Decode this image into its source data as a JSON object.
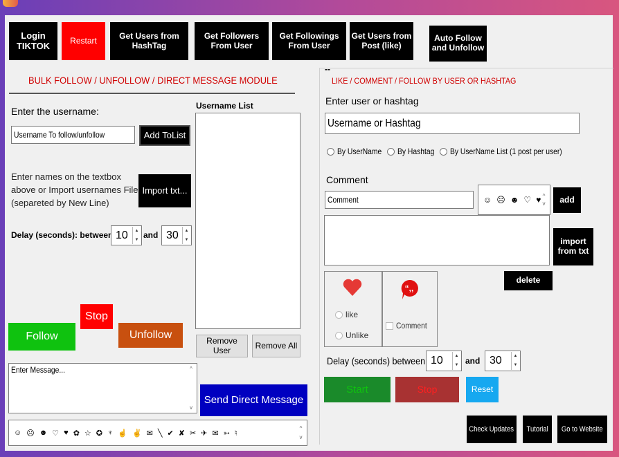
{
  "nav": {
    "login": "Login\nTIKTOK",
    "restart": "Restart",
    "hashtag": "Get Users from\nHashTag",
    "followers": "Get Followers\nFrom User",
    "followings": "Get Followings\nFrom User",
    "post": "Get Users from\nPost (like)",
    "auto": "Auto Follow\nand Unfollow"
  },
  "bulk": {
    "title": "BULK FOLLOW / UNFOLLOW / DIRECT MESSAGE MODULE",
    "enter_label": "Enter the username:",
    "username_placeholder": "Username To follow/unfollow",
    "add_list": "Add ToList",
    "help": "Enter names on the textbox\nabove or Import usernames File\n(separeted by New Line)",
    "import": "Import txt...",
    "delay_label": "Delay (seconds): between",
    "delay_from": "10",
    "delay_and": "and",
    "delay_to": "30",
    "list_label": "Username List",
    "remove_user": "Remove User",
    "remove_all": "Remove All",
    "follow": "Follow",
    "stop": "Stop",
    "unfollow": "Unfollow",
    "message_placeholder": "Enter Message...",
    "send_dm": "Send Direct Message",
    "emojis": [
      "☺",
      "☹",
      "☻",
      "♡",
      "♥",
      "✿",
      "☆",
      "✪",
      "♆",
      "☝",
      "✌",
      "✉",
      "╲",
      "✔",
      "✘",
      "✂",
      "✈",
      "✉",
      "➳",
      "♮"
    ]
  },
  "like": {
    "dash": "--",
    "title": "LIKE / COMMENT / FOLLOW BY USER OR HASHTAG",
    "enter_label": "Enter user or hashtag",
    "user_placeholder": "Username or Hashtag",
    "radio_user": "By UserName",
    "radio_hashtag": "By Hashtag",
    "radio_list": "By UserName List (1 post per user)",
    "comment_label": "Comment",
    "comment_placeholder": "Comment",
    "emojis": [
      "☺",
      "☹",
      "☻",
      "♡",
      "♥"
    ],
    "add": "add",
    "import": "import\nfrom txt",
    "delete": "delete",
    "like_opt": "like",
    "unlike_opt": "Unlike",
    "comment_opt": "Comment",
    "delay_label": "Delay (seconds) between:",
    "delay_from": "10",
    "delay_and": "and",
    "delay_to": "30",
    "start": "Start",
    "stop": "Stop",
    "reset": "Reset"
  },
  "footer": {
    "check_updates": "Check Updates",
    "tutorial": "Tutorial",
    "website": "Go to Website"
  },
  "colors": {
    "green": "#0fc20f",
    "red": "#ff0000",
    "orange": "#c8500f",
    "navy": "#0000c0",
    "heart": "#e53935"
  }
}
